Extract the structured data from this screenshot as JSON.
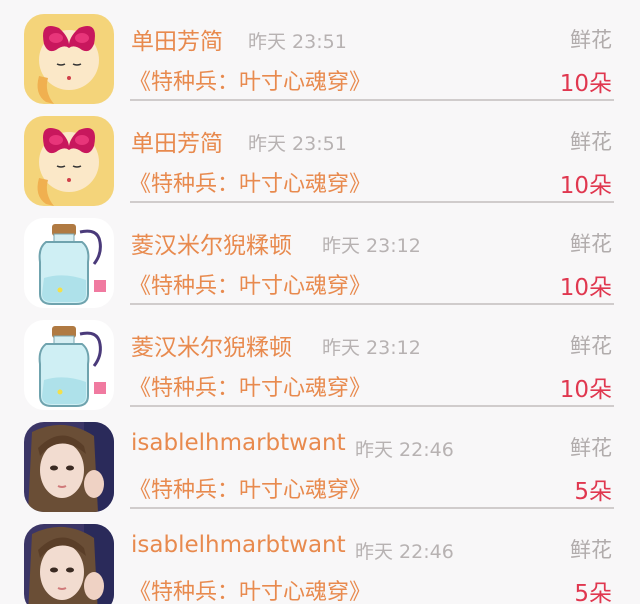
{
  "records": [
    {
      "user": "单田芳简",
      "time": "昨天 23:51",
      "gift_label": "鲜花",
      "book": "《特种兵：叶寸心魂穿》",
      "count": "10朵",
      "avatar": "cartoon-girl-avatar"
    },
    {
      "user": "单田芳简",
      "time": "昨天 23:51",
      "gift_label": "鲜花",
      "book": "《特种兵：叶寸心魂穿》",
      "count": "10朵",
      "avatar": "cartoon-girl-avatar"
    },
    {
      "user": "菱汉米尔猊糅顿",
      "time": "昨天 23:12",
      "gift_label": "鲜花",
      "book": "《特种兵：叶寸心魂穿》",
      "count": "10朵",
      "avatar": "glass-bottle-avatar"
    },
    {
      "user": "菱汉米尔猊糅顿",
      "time": "昨天 23:12",
      "gift_label": "鲜花",
      "book": "《特种兵：叶寸心魂穿》",
      "count": "10朵",
      "avatar": "glass-bottle-avatar"
    },
    {
      "user": "isablelhmarbtwant",
      "time": "昨天 22:46",
      "gift_label": "鲜花",
      "book": "《特种兵：叶寸心魂穿》",
      "count": "5朵",
      "avatar": "photo-girl-avatar"
    },
    {
      "user": "isablelhmarbtwant",
      "time": "昨天 22:46",
      "gift_label": "鲜花",
      "book": "《特种兵：叶寸心魂穿》",
      "count": "5朵",
      "avatar": "photo-girl-avatar"
    }
  ],
  "colors": {
    "name": "#e88a4e",
    "count": "#e0374f",
    "muted": "#b1acac",
    "background": "#f8f7f8"
  }
}
